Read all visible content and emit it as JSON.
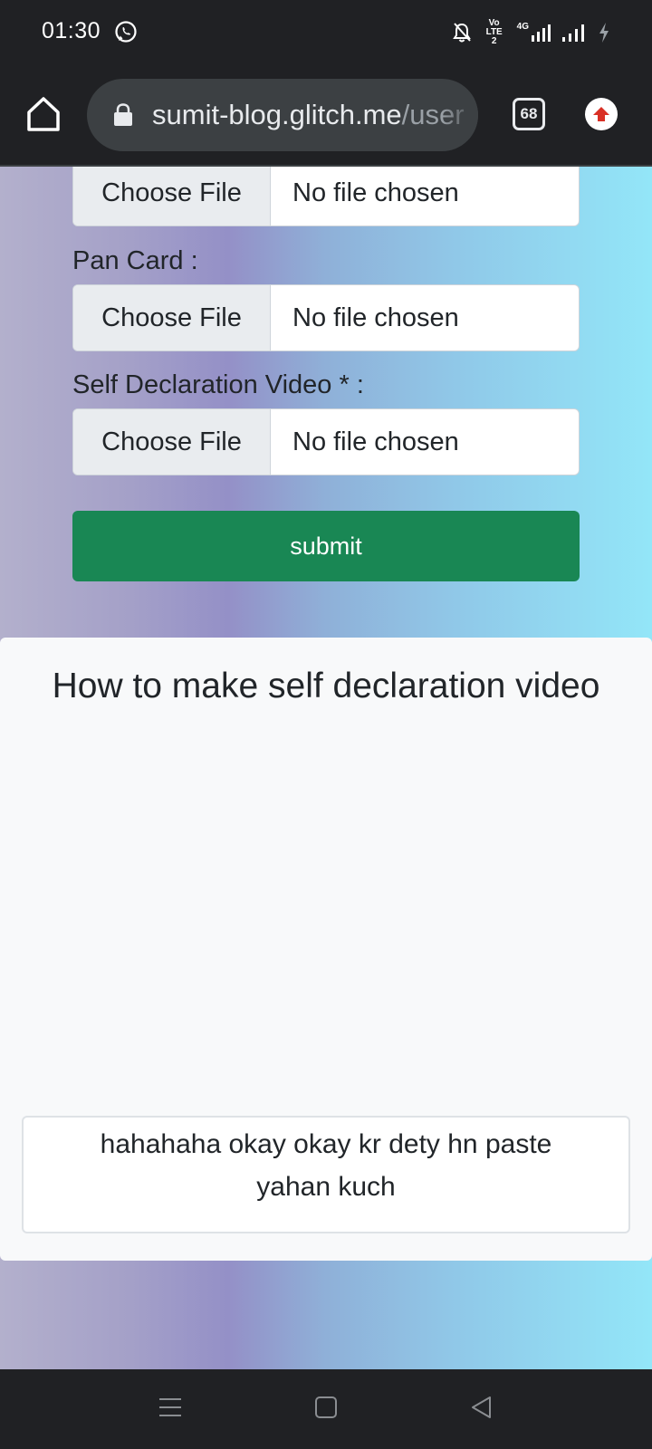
{
  "status_bar": {
    "time": "01:30",
    "volte_label": "Vo LTE 2",
    "network_label": "4G"
  },
  "browser": {
    "url_domain": "sumit-blog.glitch.me",
    "url_path": "/user",
    "tab_count": "68"
  },
  "form": {
    "fields": [
      {
        "label": "",
        "button": "Choose File",
        "status": "No file chosen"
      },
      {
        "label": "Pan Card :",
        "button": "Choose File",
        "status": "No file chosen"
      },
      {
        "label": "Self Declaration Video * :",
        "button": "Choose File",
        "status": "No file chosen"
      }
    ],
    "submit_label": "submit"
  },
  "video_card": {
    "title": "How to make self declaration video",
    "comment": "hahahaha okay okay kr dety hn paste yahan kuch"
  },
  "colors": {
    "submit": "#198754",
    "chrome_bg": "#202124",
    "upload_arrow": "#d93025"
  }
}
